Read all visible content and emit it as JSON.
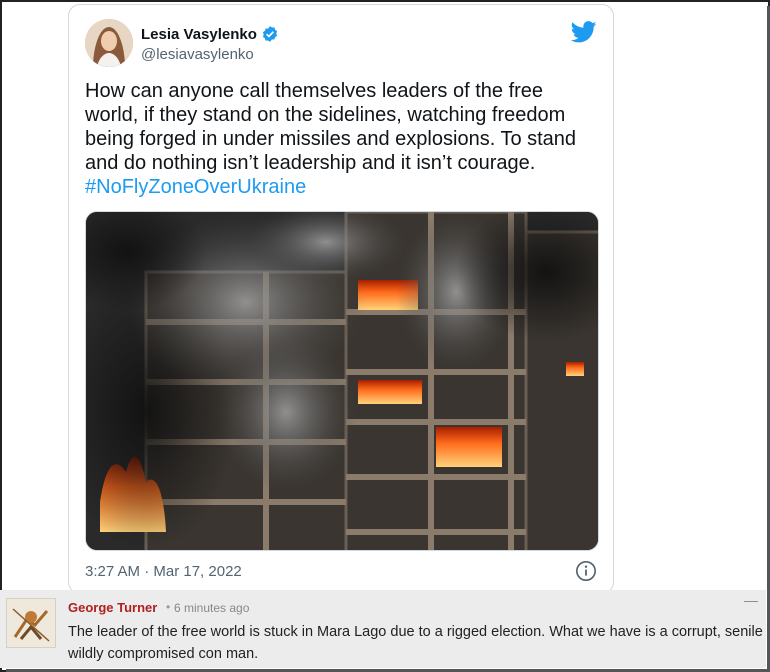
{
  "tweet": {
    "display_name": "Lesia Vasylenko",
    "handle": "@lesiavasylenko",
    "text": "How can anyone call themselves leaders of the free world, if they stand on the sidelines, watching freedom being forged in under missiles and explosions. To stand and do nothing isn’t leadership and it isn’t courage.",
    "hashtag": "#NoFlyZoneOverUkraine",
    "timestamp": "3:27 AM · Mar 17, 2022",
    "photo_alt": "",
    "brand_color": "#1d9bf0"
  },
  "comment": {
    "author": "George Turner",
    "separator": "•",
    "time": "6 minutes ago",
    "text": "The leader of the free world is stuck in Mara Lago due to a rigged election. What we have is a corrupt, senile wildly compromised con man.",
    "collapse": "—",
    "author_color": "#b02020"
  },
  "icons": [
    "verified-badge-icon",
    "twitter-bird-icon",
    "info-icon"
  ]
}
